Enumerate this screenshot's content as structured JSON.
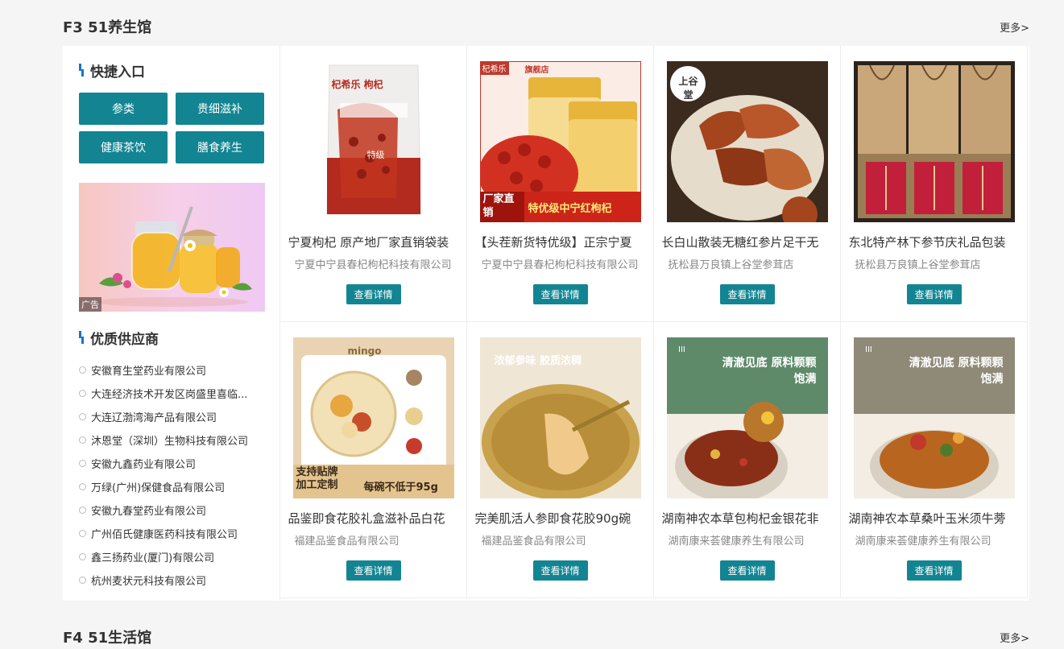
{
  "floor3": {
    "title": "F3 51养生馆",
    "more": "更多>"
  },
  "floor4": {
    "title": "F4 51生活馆",
    "more": "更多>"
  },
  "quick": {
    "title": "快捷入口",
    "buttons": [
      "参类",
      "贵细滋补",
      "健康茶饮",
      "膳食养生"
    ]
  },
  "ad": {
    "tag": "广告"
  },
  "suppliers": {
    "title": "优质供应商",
    "items": [
      "安徽育生堂药业有限公司",
      "大连经济技术开发区岗盛里喜临...",
      "大连辽渤湾海产品有限公司",
      "沐恩堂（深圳）生物科技有限公司",
      "安徽九鑫药业有限公司",
      "万绿(广州)保健食品有限公司",
      "安徽九春堂药业有限公司",
      "广州佰氏健康医药科技有限公司",
      "鑫三扬药业(厦门)有限公司",
      "杭州麦状元科技有限公司"
    ]
  },
  "products": [
    {
      "name": "宁夏枸杞 原产地厂家直销袋装",
      "company": "宁夏中宁县春杞枸杞科技有限公司",
      "button": "查看详情",
      "img_text": "杞希乐 枸杞",
      "sub_text": "特级"
    },
    {
      "name": "【头茬新货特优级】正宗宁夏",
      "company": "宁夏中宁县春杞枸杞科技有限公司",
      "button": "查看详情",
      "img_text": "旗舰店",
      "brand": "杞希乐",
      "banner_left": "厂家直销",
      "banner_right": "特优级中宁红枸杞"
    },
    {
      "name": "长白山散装无糖红参片足干无",
      "company": "抚松县万良镇上谷堂参茸店",
      "button": "查看详情",
      "img_text": "上谷堂"
    },
    {
      "name": "东北特产林下参节庆礼品包装",
      "company": "抚松县万良镇上谷堂参茸店",
      "button": "查看详情",
      "img_text": ""
    },
    {
      "name": "品鉴即食花胶礼盒滋补品白花",
      "company": "福建品鉴食品有限公司",
      "button": "查看详情",
      "img_text": "mingo",
      "banner_left": "支持贴牌 加工定制",
      "banner_right": "每碗不低于95g"
    },
    {
      "name": "完美肌活人参即食花胶90g碗",
      "company": "福建品鉴食品有限公司",
      "button": "查看详情",
      "img_text": "浓郁参味 胶质浓稠"
    },
    {
      "name": "湖南神农本草包枸杞金银花非",
      "company": "湖南康来荟健康养生有限公司",
      "button": "查看详情",
      "img_text": "清澈见底 原料颗颗饱满"
    },
    {
      "name": "湖南神农本草桑叶玉米须牛蒡",
      "company": "湖南康来荟健康养生有限公司",
      "button": "查看详情",
      "img_text": "清澈见底 原料颗颗饱满"
    }
  ],
  "colors": {
    "accent": "#138592",
    "title_mark": "#1a73c8"
  }
}
